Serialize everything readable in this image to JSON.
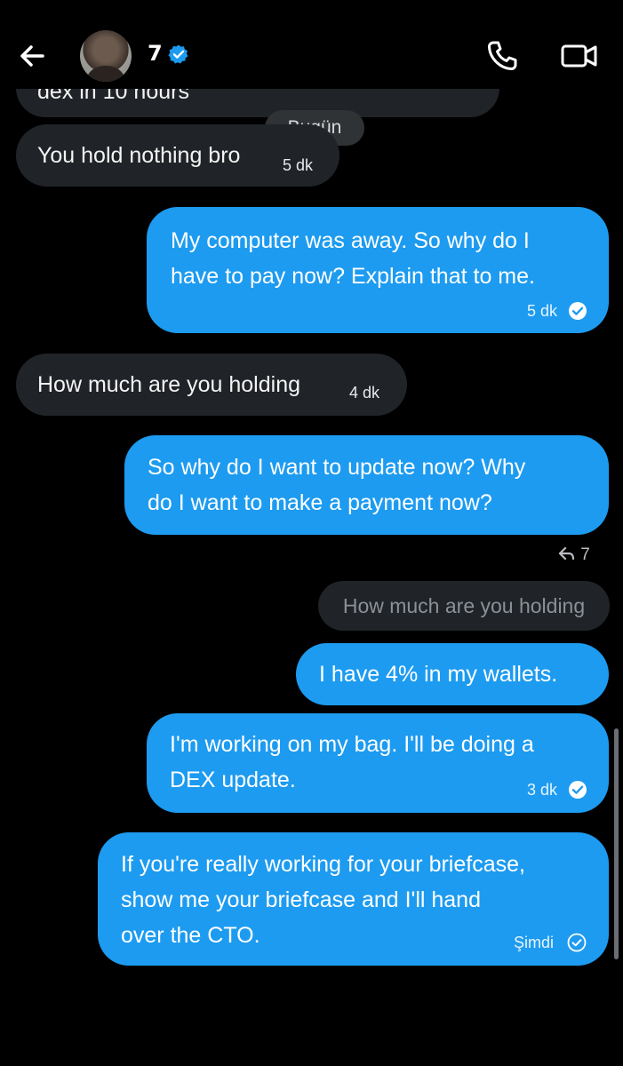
{
  "header": {
    "back_icon": "arrow-left-icon",
    "contact_name": "7",
    "verified_icon": "verified-badge-icon",
    "phone_icon": "phone-icon",
    "video_icon": "video-camera-icon"
  },
  "date_separator": "Bugün",
  "messages": [
    {
      "text": "dex in 10 hours",
      "side": "incoming",
      "time": ""
    },
    {
      "text": "You hold nothing bro",
      "side": "incoming",
      "time": "5 dk"
    },
    {
      "text": "My computer was away. So why do I have to pay now? Explain that to me.",
      "lines": [
        "My computer was away. So why do I",
        "have to pay now? Explain that to me."
      ],
      "side": "outgoing",
      "time": "5 dk",
      "read": true
    },
    {
      "text": "How much are you holding",
      "side": "incoming",
      "time": "4 dk"
    },
    {
      "text": "So why do I want to update now? Why do I want to make a payment now?",
      "lines": [
        "So why do I want to update now? Why",
        "do I want to make a payment now?"
      ],
      "side": "outgoing",
      "time": "",
      "read": false
    },
    {
      "reply_to": "7",
      "quoted": "How much are you holding"
    },
    {
      "text": "I have 4% in my wallets.",
      "side": "outgoing",
      "time": ""
    },
    {
      "text": "I'm working on my bag. I'll be doing a DEX update.",
      "lines": [
        "I'm working on my bag. I'll be doing a",
        "DEX update."
      ],
      "side": "outgoing",
      "time": "3 dk",
      "read": true
    },
    {
      "text": "If you're really working for your briefcase, show me your briefcase and I'll hand over the CTO.",
      "lines": [
        "If you're really working for your briefcase,",
        "show me your briefcase and I'll hand",
        "over the CTO."
      ],
      "side": "outgoing",
      "time": "Şimdi",
      "read": false
    }
  ],
  "colors": {
    "background": "#000000",
    "incoming_bubble": "#202327",
    "outgoing_bubble": "#1d9bf0",
    "verified_blue": "#1d9bf0"
  }
}
